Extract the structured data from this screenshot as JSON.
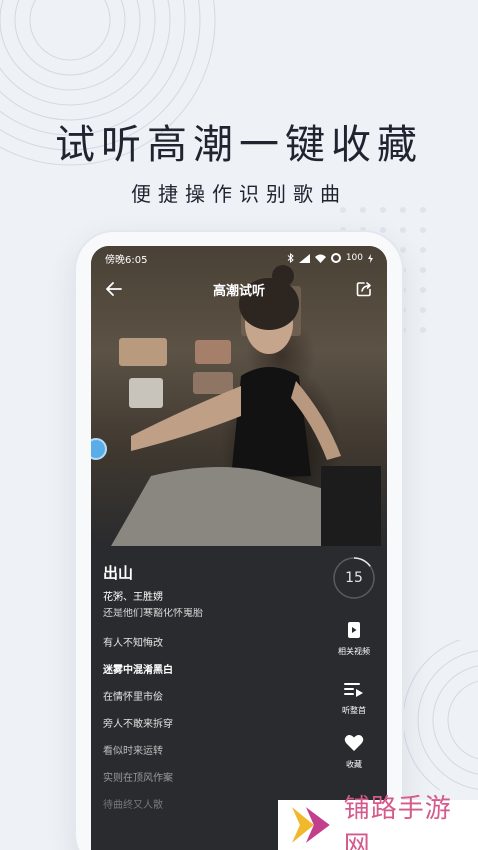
{
  "promo": {
    "headline": "试听高潮一键收藏",
    "subline": "便捷操作识别歌曲"
  },
  "status_bar": {
    "time": "傍晚6:05",
    "battery": "100"
  },
  "nav": {
    "title": "高潮试听"
  },
  "song": {
    "title": "出山",
    "artist": "花粥、王胜娚"
  },
  "lyrics": [
    {
      "text": "还是他们寒豁化怀嵬胎",
      "state": "faded"
    },
    {
      "text": "有人不知悔改",
      "state": "normal"
    },
    {
      "text": "迷雾中混淆黑白",
      "state": "current"
    },
    {
      "text": "在情怀里市侩",
      "state": "normal"
    },
    {
      "text": "旁人不敢来拆穿",
      "state": "normal"
    },
    {
      "text": "看似时来运转",
      "state": "dim"
    },
    {
      "text": "实则在顶风作案",
      "state": "dimmer"
    },
    {
      "text": "待曲终又人散",
      "state": "dimmest"
    }
  ],
  "timer": {
    "seconds": "15",
    "progress": 0.15
  },
  "actions": {
    "video_label": "相关视频",
    "full_song_label": "听整首",
    "favorite_label": "收藏"
  },
  "watermark": {
    "text": "铺路手游网"
  },
  "colors": {
    "background": "#eef1f5",
    "headline": "#1f2430",
    "screen": "#2a2b2e",
    "accent_watermark": "#d45a8a"
  }
}
